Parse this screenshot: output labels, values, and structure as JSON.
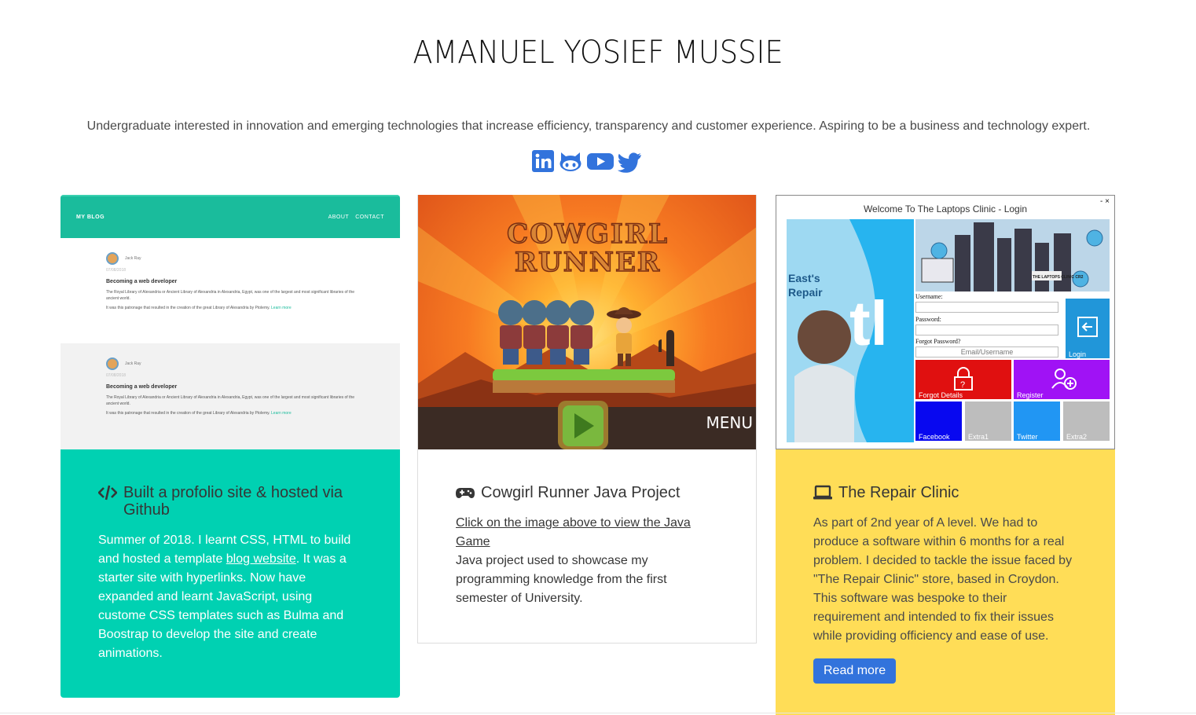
{
  "header": {
    "title": "AMANUEL YOSIEF MUSSIE",
    "tagline": "Undergraduate interested in innovation and emerging technologies that increase efficiency, transparency and customer experience. Aspiring to be a business and technology expert."
  },
  "socials": [
    {
      "name": "linkedin-icon",
      "color": "#3273dc"
    },
    {
      "name": "github-icon",
      "color": "#3273dc"
    },
    {
      "name": "youtube-icon",
      "color": "#3273dc"
    },
    {
      "name": "twitter-icon",
      "color": "#3273dc"
    }
  ],
  "cards": [
    {
      "title": "Built a profolio site & hosted via Github",
      "icon": "code-icon",
      "text_before": "Summer of 2018. I learnt CSS, HTML to build and hosted a template ",
      "link": "blog website",
      "text_after": ". It was a starter site with hyperlinks. Now have expanded and learnt JavaScript, using custome CSS templates such as Bulma and Boostrap to develop the site and create animations.",
      "color": "#00d1b2",
      "preview": {
        "brand": "MY BLOG",
        "nav": [
          "ABOUT",
          "CONTACT"
        ],
        "posts": [
          {
            "author": "Jack Ray",
            "date": "07/08/2018",
            "heading": "Becoming a web developer",
            "p1": "The Royal Library of Alexandria or Ancient Library of Alexandria in Alexandria, Egypt, was one of the largest and most significant libraries of the ancient world.",
            "p2": "It was this patronage that resulted in the creation of the great Library of Alexandria by Ptolemy.",
            "more": "Learn more"
          },
          {
            "author": "Jack Ray",
            "date": "07/08/2018",
            "heading": "Becoming a web developer",
            "p1": "The Royal Library of Alexandria or Ancient Library of Alexandria in Alexandria, Egypt, was one of the largest and most significant libraries of the ancient world.",
            "p2": "It was this patronage that resulted in the creation of the great Library of Alexandria by Ptolemy.",
            "more": "Learn more"
          }
        ]
      }
    },
    {
      "title": "Cowgirl Runner Java Project",
      "icon": "gamepad-icon",
      "link": "Click on the image above to view the Java Game",
      "text": "Java project used to showcase my programming knowledge from the first semester of University.",
      "preview": {
        "game_title_line1": "COWGIRL",
        "game_title_line2": "RUNNER",
        "menu": "MENU"
      }
    },
    {
      "title": "The Repair Clinic",
      "icon": "laptop-icon",
      "text": "As part of 2nd year of A level. We had to produce a software within 6 months for a real problem. I decided to tackle the issue faced by \"The Repair Clinic\" store, based in Croydon. This software was bespoke to their requirement and intended to fix their issues while providing officiency and ease of use.",
      "button": "Read more",
      "color": "#ffdd57",
      "preview": {
        "window_title": "Welcome To The Laptops Clinic - Login",
        "window_controls": "-  ×",
        "username_label": "Username:",
        "password_label": "Password:",
        "forgot_label": "Forgot Password?",
        "email_placeholder": "Email/Username",
        "tiles": [
          "Login",
          "Forgot Details",
          "Register",
          "Facebook",
          "Extra1",
          "Twitter",
          "Extra2"
        ],
        "banner_text": "THE LAPTOPS CLINIC CR2",
        "side_text": "East's Repair"
      }
    }
  ]
}
